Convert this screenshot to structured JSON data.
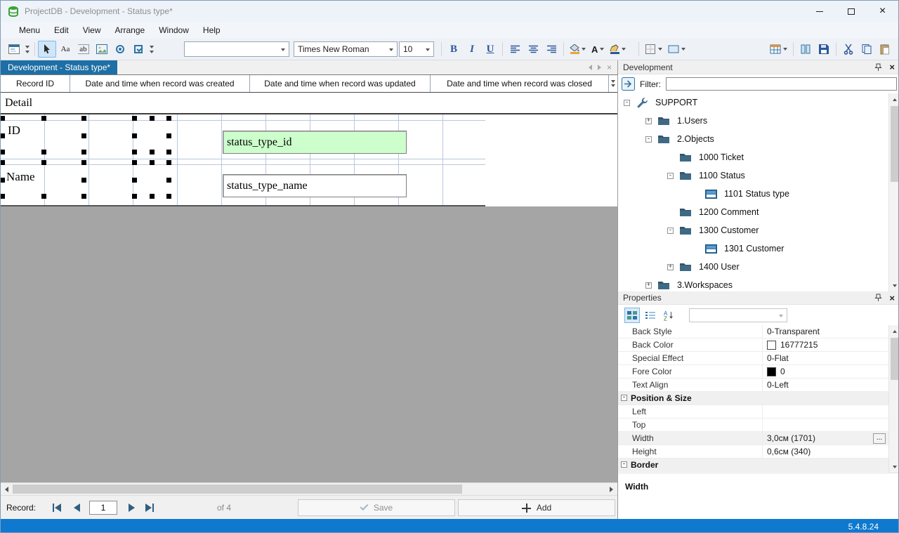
{
  "glyphs": {
    "close": "×"
  },
  "colors": {
    "accent_tab": "#1d6fa5",
    "statusbar": "#0e79cf",
    "field_highlight": "#ccffcc",
    "selection_handles": "#000000"
  },
  "titlebar": {
    "title": "ProjectDB - Development - Status type*"
  },
  "menubar": {
    "items": [
      "Menu",
      "Edit",
      "View",
      "Arrange",
      "Window",
      "Help"
    ]
  },
  "toolbar": {
    "label_tool": "Aa",
    "textbox_tool": "ab",
    "font_name": "Times New Roman",
    "font_size": "10",
    "bold": "B",
    "italic": "I",
    "underline": "U",
    "font_color_letter": "A"
  },
  "tabstrip": {
    "active_tab": "Development - Status type*"
  },
  "designer": {
    "columns": [
      "Record ID",
      "Date and time when record was created",
      "Date and time when record was updated",
      "Date and time when record was closed"
    ],
    "band_label": "Detail",
    "rows": [
      {
        "label": "ID",
        "control_text": "status_type_id",
        "background": "#ccffcc"
      },
      {
        "label": "Name",
        "control_text": "status_type_name",
        "background": "#ffffff"
      }
    ]
  },
  "development_panel": {
    "title": "Development",
    "filter_label": "Filter:",
    "filter_value": "",
    "tree": [
      {
        "label": "SUPPORT",
        "icon": "wrench",
        "expander": "-",
        "level": 0
      },
      {
        "label": "1.Users",
        "icon": "folder",
        "expander": "+",
        "level": 1
      },
      {
        "label": "2.Objects",
        "icon": "folder",
        "expander": "-",
        "level": 1
      },
      {
        "label": "1000 Ticket",
        "icon": "folder",
        "expander": "",
        "level": 2
      },
      {
        "label": "1100 Status",
        "icon": "folder",
        "expander": "-",
        "level": 2
      },
      {
        "label": "1101 Status type",
        "icon": "form",
        "expander": "",
        "level": 3
      },
      {
        "label": "1200 Comment",
        "icon": "folder",
        "expander": "",
        "level": 2
      },
      {
        "label": "1300 Customer",
        "icon": "folder",
        "expander": "-",
        "level": 2
      },
      {
        "label": "1301 Customer",
        "icon": "form",
        "expander": "",
        "level": 3
      },
      {
        "label": "1400 User",
        "icon": "folder",
        "expander": "+",
        "level": 2
      },
      {
        "label": "3.Workspaces",
        "icon": "folder",
        "expander": "+",
        "level": 1
      }
    ]
  },
  "properties_panel": {
    "title": "Properties",
    "collapse": "-",
    "sort_a": "A",
    "sort_z": "Z",
    "ellipsis": "...",
    "rows": [
      {
        "name": "Back Style",
        "value": "0-Transparent"
      },
      {
        "name": "Back Color",
        "value": "16777215",
        "swatch": "#ffffff"
      },
      {
        "name": "Special Effect",
        "value": "0-Flat"
      },
      {
        "name": "Fore Color",
        "value": "0",
        "swatch": "#000000"
      },
      {
        "name": "Text Align",
        "value": "0-Left"
      },
      {
        "name": "Position & Size",
        "category": true
      },
      {
        "name": "Left",
        "value": ""
      },
      {
        "name": "Top",
        "value": ""
      },
      {
        "name": "Width",
        "value": "3,0см (1701)",
        "selected": true
      },
      {
        "name": "Height",
        "value": "0,6см (340)"
      },
      {
        "name": "Border",
        "category": true
      }
    ],
    "description": "Width"
  },
  "record_bar": {
    "label": "Record:",
    "current": "1",
    "count_label": "of 4",
    "save_label": "Save",
    "add_label": "Add"
  },
  "statusbar": {
    "version": "5.4.8.24"
  }
}
